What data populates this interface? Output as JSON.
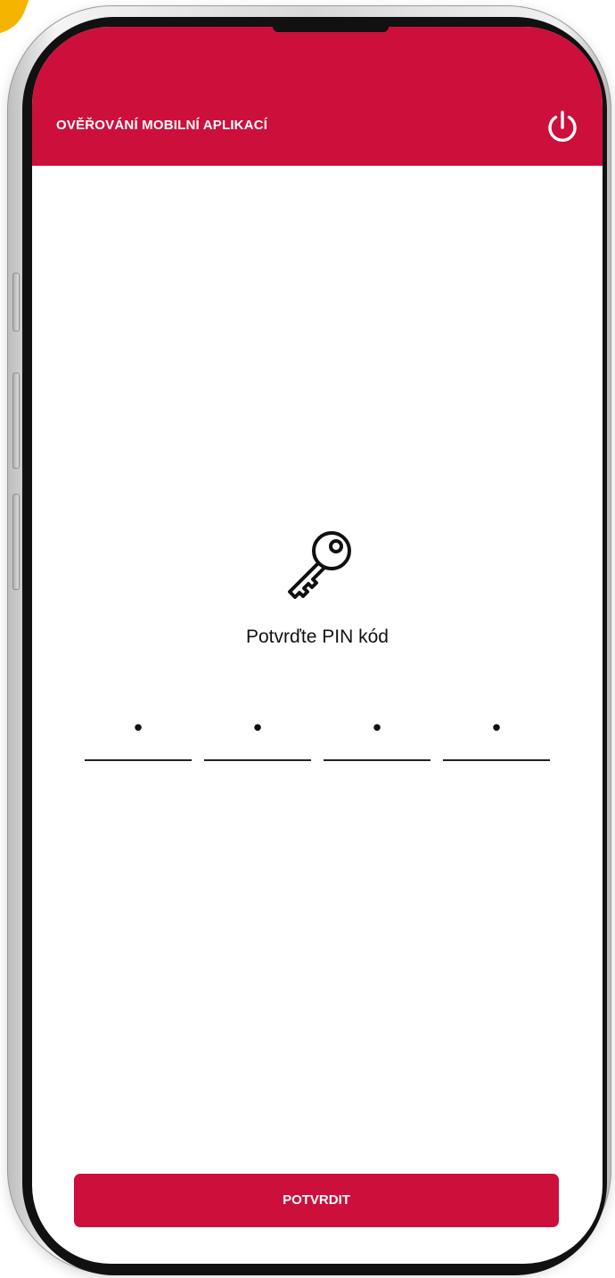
{
  "header": {
    "title": "OVĚŘOVÁNÍ MOBILNÍ APLIKACÍ",
    "power_icon": "power-icon"
  },
  "main": {
    "key_icon": "key-icon",
    "prompt": "Potvrďte PIN kód",
    "pin_fields": [
      "•",
      "•",
      "•",
      "•"
    ]
  },
  "footer": {
    "confirm_label": "POTVRDIT"
  },
  "colors": {
    "brand": "#cc103b",
    "text": "#111111",
    "background": "#ffffff"
  }
}
